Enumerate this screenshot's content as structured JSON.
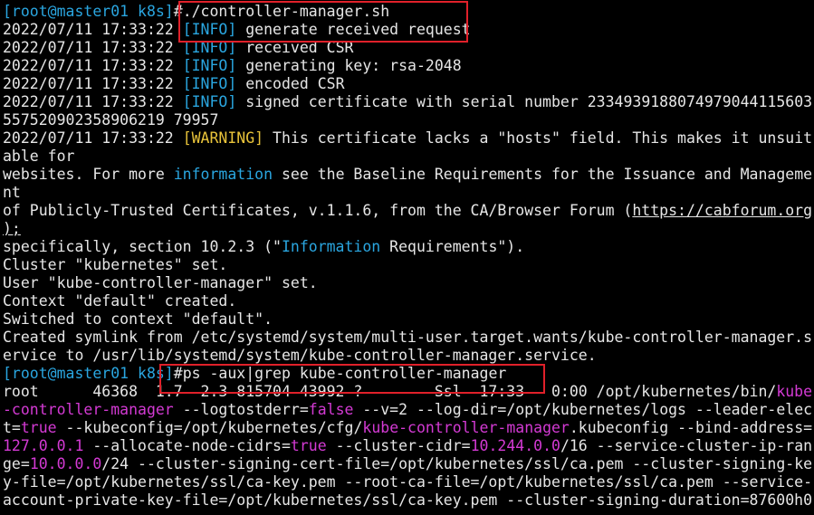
{
  "terminal": {
    "lines": [
      {
        "segs": [
          {
            "t": "[root@master01 k8s]",
            "c": "cyan"
          },
          {
            "t": "#",
            "c": "white"
          },
          {
            "t": "./controller-manager.sh",
            "c": "white"
          }
        ]
      },
      {
        "segs": [
          {
            "t": "2022/07/11 17:33:22 ",
            "c": "white"
          },
          {
            "t": "[INFO]",
            "c": "cyan"
          },
          {
            "t": " generate received request",
            "c": "white"
          }
        ]
      },
      {
        "segs": [
          {
            "t": "2022/07/11 17:33:22 ",
            "c": "white"
          },
          {
            "t": "[INFO]",
            "c": "cyan"
          },
          {
            "t": " received CSR",
            "c": "white"
          }
        ]
      },
      {
        "segs": [
          {
            "t": "2022/07/11 17:33:22 ",
            "c": "white"
          },
          {
            "t": "[INFO]",
            "c": "cyan"
          },
          {
            "t": " generating key: rsa-2048",
            "c": "white"
          }
        ]
      },
      {
        "segs": [
          {
            "t": "2022/07/11 17:33:22 ",
            "c": "white"
          },
          {
            "t": "[INFO]",
            "c": "cyan"
          },
          {
            "t": " encoded CSR",
            "c": "white"
          }
        ]
      },
      {
        "segs": [
          {
            "t": "2022/07/11 17:33:22 ",
            "c": "white"
          },
          {
            "t": "[INFO]",
            "c": "cyan"
          },
          {
            "t": " signed certificate with serial number 233493918807497904411560​3",
            "c": "white"
          }
        ]
      },
      {
        "segs": [
          {
            "t": "557520902358906219 79957",
            "c": "white"
          }
        ]
      },
      {
        "segs": [
          {
            "t": "2022/07/11 17:33:22 ",
            "c": "white"
          },
          {
            "t": "[WARNING]",
            "c": "yellow"
          },
          {
            "t": " This certificate lacks a \"hosts\" field. This makes it unsuit",
            "c": "white"
          }
        ]
      },
      {
        "segs": [
          {
            "t": "able for",
            "c": "white"
          }
        ]
      },
      {
        "segs": [
          {
            "t": "websites. For more ",
            "c": "white"
          },
          {
            "t": "information",
            "c": "cyan"
          },
          {
            "t": " see the Baseline Requirements for the Issuance and Manageme",
            "c": "white"
          }
        ]
      },
      {
        "segs": [
          {
            "t": "nt",
            "c": "white"
          }
        ]
      },
      {
        "segs": [
          {
            "t": "of Publicly-Trusted Certificates, v.1.1.6, from the CA/Browser Forum (",
            "c": "white"
          },
          {
            "t": "https://cabforum.org",
            "c": "link"
          }
        ]
      },
      {
        "segs": [
          {
            "t": ");",
            "c": "link"
          }
        ]
      },
      {
        "segs": [
          {
            "t": "specifically, section 10.2.3 (\"",
            "c": "white"
          },
          {
            "t": "Information",
            "c": "cyan"
          },
          {
            "t": " Requirements\").",
            "c": "white"
          }
        ]
      },
      {
        "segs": [
          {
            "t": "Cluster \"kubernetes\" set.",
            "c": "white"
          }
        ]
      },
      {
        "segs": [
          {
            "t": "User \"kube-controller-manager\" set.",
            "c": "white"
          }
        ]
      },
      {
        "segs": [
          {
            "t": "Context \"default\" created.",
            "c": "white"
          }
        ]
      },
      {
        "segs": [
          {
            "t": "Switched to context \"default\".",
            "c": "white"
          }
        ]
      },
      {
        "segs": [
          {
            "t": "Created symlink from /etc/systemd/system/multi-user.target.wants/kube-controller-manager.s",
            "c": "white"
          }
        ]
      },
      {
        "segs": [
          {
            "t": "ervice to /usr/lib/systemd/system/kube-controller-manager.service.",
            "c": "white"
          }
        ]
      },
      {
        "segs": [
          {
            "t": "[root@master01 k8s]",
            "c": "cyan"
          },
          {
            "t": "#",
            "c": "white"
          },
          {
            "t": "ps -aux|grep kube-controller-manager",
            "c": "white"
          }
        ]
      },
      {
        "segs": [
          {
            "t": "root      46368  1.7  2.3 815704 43992 ?        Ssl  17:33   0:00 /opt/kubernetes/bin/",
            "c": "white"
          },
          {
            "t": "kube",
            "c": "mag"
          }
        ]
      },
      {
        "segs": [
          {
            "t": "-controller-manager",
            "c": "mag"
          },
          {
            "t": " --logtostderr=",
            "c": "white"
          },
          {
            "t": "false",
            "c": "mag"
          },
          {
            "t": " --v=2 --log-dir=/opt/kubernetes/logs --leader-elec",
            "c": "white"
          }
        ]
      },
      {
        "segs": [
          {
            "t": "t=",
            "c": "white"
          },
          {
            "t": "true",
            "c": "mag"
          },
          {
            "t": " --kubeconfig=/opt/kubernetes/cfg/",
            "c": "white"
          },
          {
            "t": "kube-controller-manager",
            "c": "mag"
          },
          {
            "t": ".kubeconfig --bind-address=",
            "c": "white"
          }
        ]
      },
      {
        "segs": [
          {
            "t": "127.0.0.1",
            "c": "mag"
          },
          {
            "t": " --allocate-node-cidrs=",
            "c": "white"
          },
          {
            "t": "true",
            "c": "mag"
          },
          {
            "t": " --cluster-cidr=",
            "c": "white"
          },
          {
            "t": "10.244.0.0",
            "c": "mag"
          },
          {
            "t": "/16 --service-cluster-ip-ran",
            "c": "white"
          }
        ]
      },
      {
        "segs": [
          {
            "t": "ge=",
            "c": "white"
          },
          {
            "t": "10.0.0.0",
            "c": "mag"
          },
          {
            "t": "/24 --cluster-signing-cert-file=/opt/kubernetes/ssl/ca.pem --cluster-signing-ke",
            "c": "white"
          }
        ]
      },
      {
        "segs": [
          {
            "t": "y-file=/opt/kubernetes/ssl/ca-key.pem --root-ca-file=/opt/kubernetes/ssl/ca.pem --service-",
            "c": "white"
          }
        ]
      },
      {
        "segs": [
          {
            "t": "account-private-key-file=/opt/kubernetes/ssl/ca-key.pem --cluster-signing-duration=87600h0",
            "c": "white"
          }
        ]
      }
    ]
  }
}
